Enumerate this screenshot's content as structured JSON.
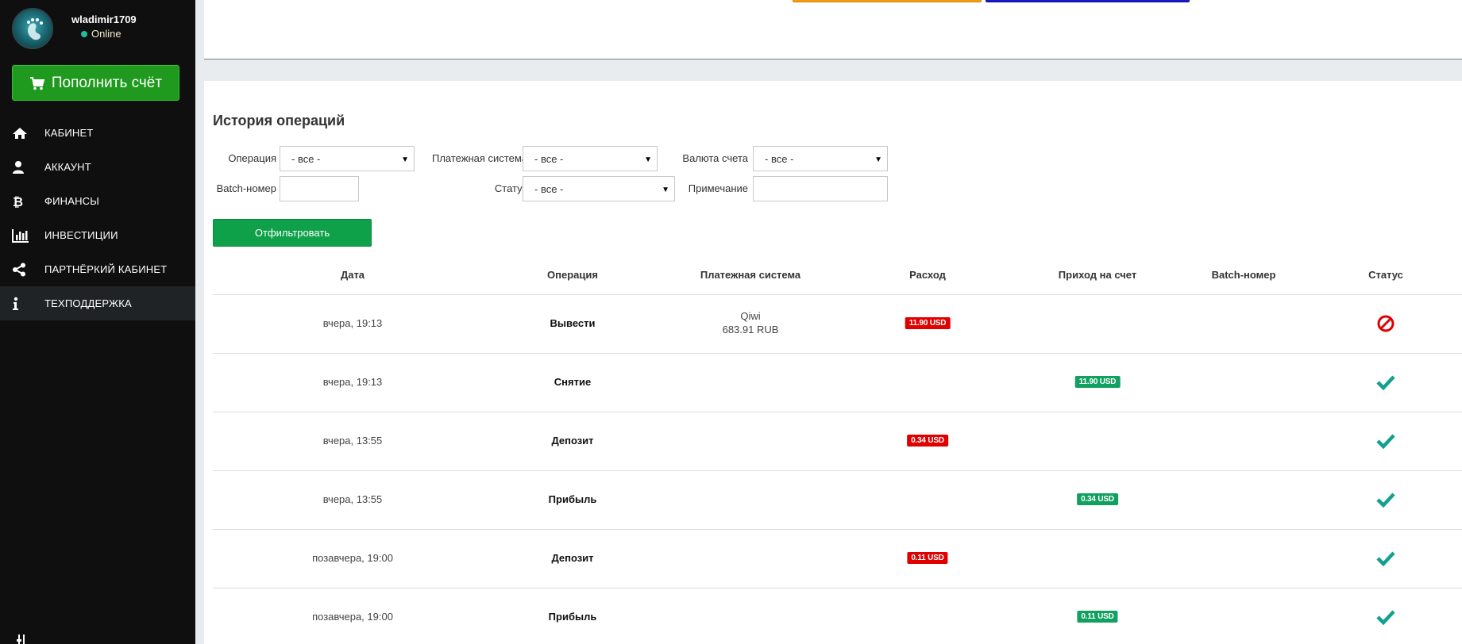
{
  "user": {
    "name": "wladimir1709",
    "status": "Online"
  },
  "sidebar": {
    "topup_label": "Пополнить счёт",
    "items": [
      {
        "label": "КАБИНЕТ",
        "icon": "home-icon"
      },
      {
        "label": "АККАУНТ",
        "icon": "user-icon"
      },
      {
        "label": "ФИНАНСЫ",
        "icon": "bitcoin-icon"
      },
      {
        "label": "ИНВЕСТИЦИИ",
        "icon": "bar-chart-icon"
      },
      {
        "label": "ПАРТНЁРКИЙ КАБИНЕТ",
        "icon": "share-icon"
      },
      {
        "label": "ТЕХПОДДЕРЖКА",
        "icon": "info-icon"
      }
    ]
  },
  "history": {
    "title": "История операций",
    "filters": {
      "operation_label": "Операция",
      "operation_value": "- все -",
      "payment_system_label": "Платежная система",
      "payment_system_value": "- все -",
      "currency_label": "Валюта счета",
      "currency_value": "- все -",
      "batch_label": "Batch-номер",
      "batch_value": "",
      "status_label": "Статус",
      "status_value": "- все -",
      "note_label": "Примечание",
      "note_value": "",
      "submit_label": "Отфильтровать"
    },
    "columns": [
      "Дата",
      "Операция",
      "Платежная система",
      "Расход",
      "Приход на счет",
      "Batch-номер",
      "Статус"
    ],
    "rows": [
      {
        "date": "вчера, 19:13",
        "operation": "Вывести",
        "system": "Qiwi",
        "system_amount": "683.91 RUB",
        "expense": "11.90 USD",
        "income": "",
        "batch": "",
        "status": "cancelled-icon"
      },
      {
        "date": "вчера, 19:13",
        "operation": "Снятие",
        "system": "",
        "system_amount": "",
        "expense": "",
        "income": "11.90 USD",
        "batch": "",
        "status": "check-icon"
      },
      {
        "date": "вчера, 13:55",
        "operation": "Депозит",
        "system": "",
        "system_amount": "",
        "expense": "0.34 USD",
        "income": "",
        "batch": "",
        "status": "check-icon"
      },
      {
        "date": "вчера, 13:55",
        "operation": "Прибыль",
        "system": "",
        "system_amount": "",
        "expense": "",
        "income": "0.34 USD",
        "batch": "",
        "status": "check-icon"
      },
      {
        "date": "позавчера, 19:00",
        "operation": "Депозит",
        "system": "",
        "system_amount": "",
        "expense": "0.11 USD",
        "income": "",
        "batch": "",
        "status": "check-icon"
      },
      {
        "date": "позавчера, 19:00",
        "operation": "Прибыль",
        "system": "",
        "system_amount": "",
        "expense": "",
        "income": "0.11 USD",
        "batch": "",
        "status": "check-icon"
      }
    ]
  },
  "colors": {
    "sidebar_bg": "#0f0f0f",
    "topup_green": "#1f9a1f",
    "filter_green": "#0fa14a",
    "expense_red": "#e00000",
    "income_green": "#12a060",
    "check_teal": "#12a090"
  }
}
